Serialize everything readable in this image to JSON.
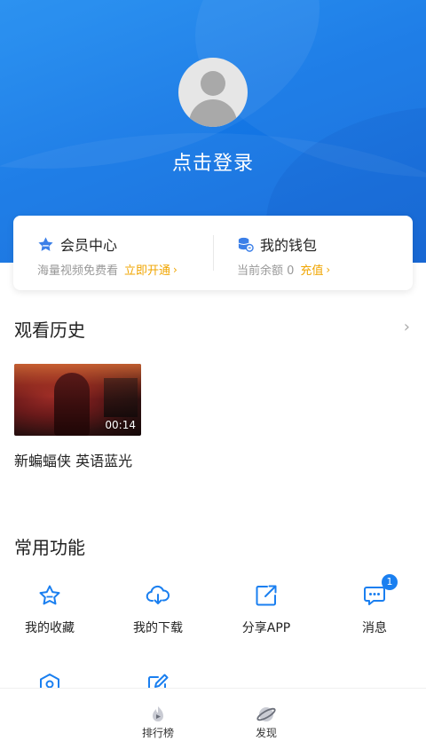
{
  "profile": {
    "login_label": "点击登录"
  },
  "member_card": {
    "vip": {
      "title": "会员中心",
      "subtitle": "海量视频免费看",
      "action": "立即开通"
    },
    "wallet": {
      "title": "我的钱包",
      "subtitle": "当前余额 0",
      "action": "充值"
    }
  },
  "history": {
    "title": "观看历史",
    "items": [
      {
        "title": "新蝙蝠侠 英语蓝光",
        "duration": "00:14"
      }
    ]
  },
  "functions": {
    "title": "常用功能",
    "items": [
      {
        "label": "我的收藏",
        "icon": "star-icon"
      },
      {
        "label": "我的下载",
        "icon": "cloud-download-icon"
      },
      {
        "label": "分享APP",
        "icon": "share-icon"
      },
      {
        "label": "消息",
        "icon": "message-icon",
        "badge": "1"
      },
      {
        "label": "",
        "icon": "settings-icon"
      },
      {
        "label": "",
        "icon": "edit-icon"
      }
    ]
  },
  "tabbar": {
    "items": [
      {
        "label": "排行榜",
        "icon": "rank-icon"
      },
      {
        "label": "发现",
        "icon": "discover-icon"
      }
    ]
  },
  "colors": {
    "accent": "#1a7ff0",
    "header_blue": "#1478e6",
    "action_yellow": "#f0a500"
  }
}
